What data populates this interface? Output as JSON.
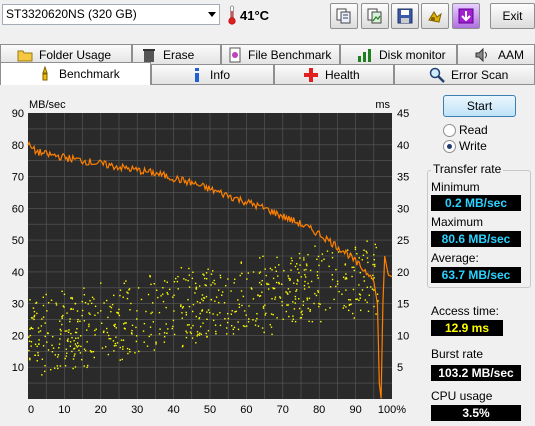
{
  "toolbar": {
    "drive": "ST3320620NS (320 GB)",
    "temperature": "41°C",
    "buttons": [
      "copy-text-icon",
      "copy-image-icon",
      "save-icon",
      "options-icon",
      "download-icon"
    ],
    "exit_label": "Exit"
  },
  "tabs_row1": [
    {
      "label": "Folder Usage",
      "icon": "folder-icon"
    },
    {
      "label": "Erase",
      "icon": "trash-icon"
    },
    {
      "label": "File Benchmark",
      "icon": "file-benchmark-icon"
    },
    {
      "label": "Disk monitor",
      "icon": "disk-monitor-icon"
    },
    {
      "label": "AAM",
      "icon": "speaker-icon"
    }
  ],
  "tabs_row2": [
    {
      "label": "Benchmark",
      "icon": "benchmark-icon",
      "active": true
    },
    {
      "label": "Info",
      "icon": "info-icon"
    },
    {
      "label": "Health",
      "icon": "health-icon"
    },
    {
      "label": "Error Scan",
      "icon": "error-scan-icon"
    }
  ],
  "controls": {
    "start_label": "Start",
    "mode_options": [
      "Read",
      "Write"
    ],
    "mode_selected": "Write"
  },
  "stats": {
    "transfer_rate_title": "Transfer rate",
    "minimum_label": "Minimum",
    "minimum_value": "0.2 MB/sec",
    "maximum_label": "Maximum",
    "maximum_value": "80.6 MB/sec",
    "average_label": "Average:",
    "average_value": "63.7 MB/sec",
    "access_time_label": "Access time:",
    "access_time_value": "12.9 ms",
    "burst_rate_label": "Burst rate",
    "burst_rate_value": "103.2 MB/sec",
    "cpu_usage_label": "CPU usage",
    "cpu_usage_value": "3.5%"
  },
  "colors": {
    "chart_bg": "#2a2a2a",
    "grid": "#5a5a5a",
    "transfer_line": "#ff8000",
    "access_points": "#ffff00",
    "value_cyan": "#2bd3ff",
    "value_yellow": "#ffff00",
    "value_white": "#ffffff"
  },
  "chart_data": {
    "type": "line",
    "left_axis_label": "MB/sec",
    "right_axis_label": "ms",
    "ylim_left": [
      0,
      90
    ],
    "ylim_right": [
      0,
      45
    ],
    "xlim": [
      0,
      100
    ],
    "x_unit": "%",
    "left_ticks": [
      "10",
      "20",
      "30",
      "40",
      "50",
      "60",
      "70",
      "80",
      "90"
    ],
    "right_ticks": [
      "5",
      "10",
      "15",
      "20",
      "25",
      "30",
      "35",
      "40",
      "45"
    ],
    "x_ticks": [
      "0",
      "10",
      "20",
      "30",
      "40",
      "50",
      "60",
      "70",
      "80",
      "90",
      "100%"
    ],
    "grid": true,
    "series": [
      {
        "axis": "left",
        "x": [
          0,
          2,
          5,
          8,
          10,
          15,
          20,
          25,
          30,
          35,
          40,
          45,
          50,
          55,
          60,
          65,
          70,
          75,
          80,
          85,
          88,
          90,
          92,
          94,
          95,
          96,
          96.5,
          97,
          97.5,
          98,
          99,
          100
        ],
        "values": [
          80,
          78,
          77,
          76.5,
          76,
          75,
          74,
          73,
          72,
          71,
          69.5,
          68,
          66,
          64,
          62,
          60,
          57.5,
          55,
          52,
          48,
          45.5,
          43,
          41,
          39,
          37,
          30,
          5,
          0.2,
          30,
          45,
          39,
          38.5
        ]
      },
      {
        "axis": "right",
        "type": "scatter",
        "trend_start": 10,
        "trend_end": 20,
        "spread": 7
      }
    ]
  }
}
